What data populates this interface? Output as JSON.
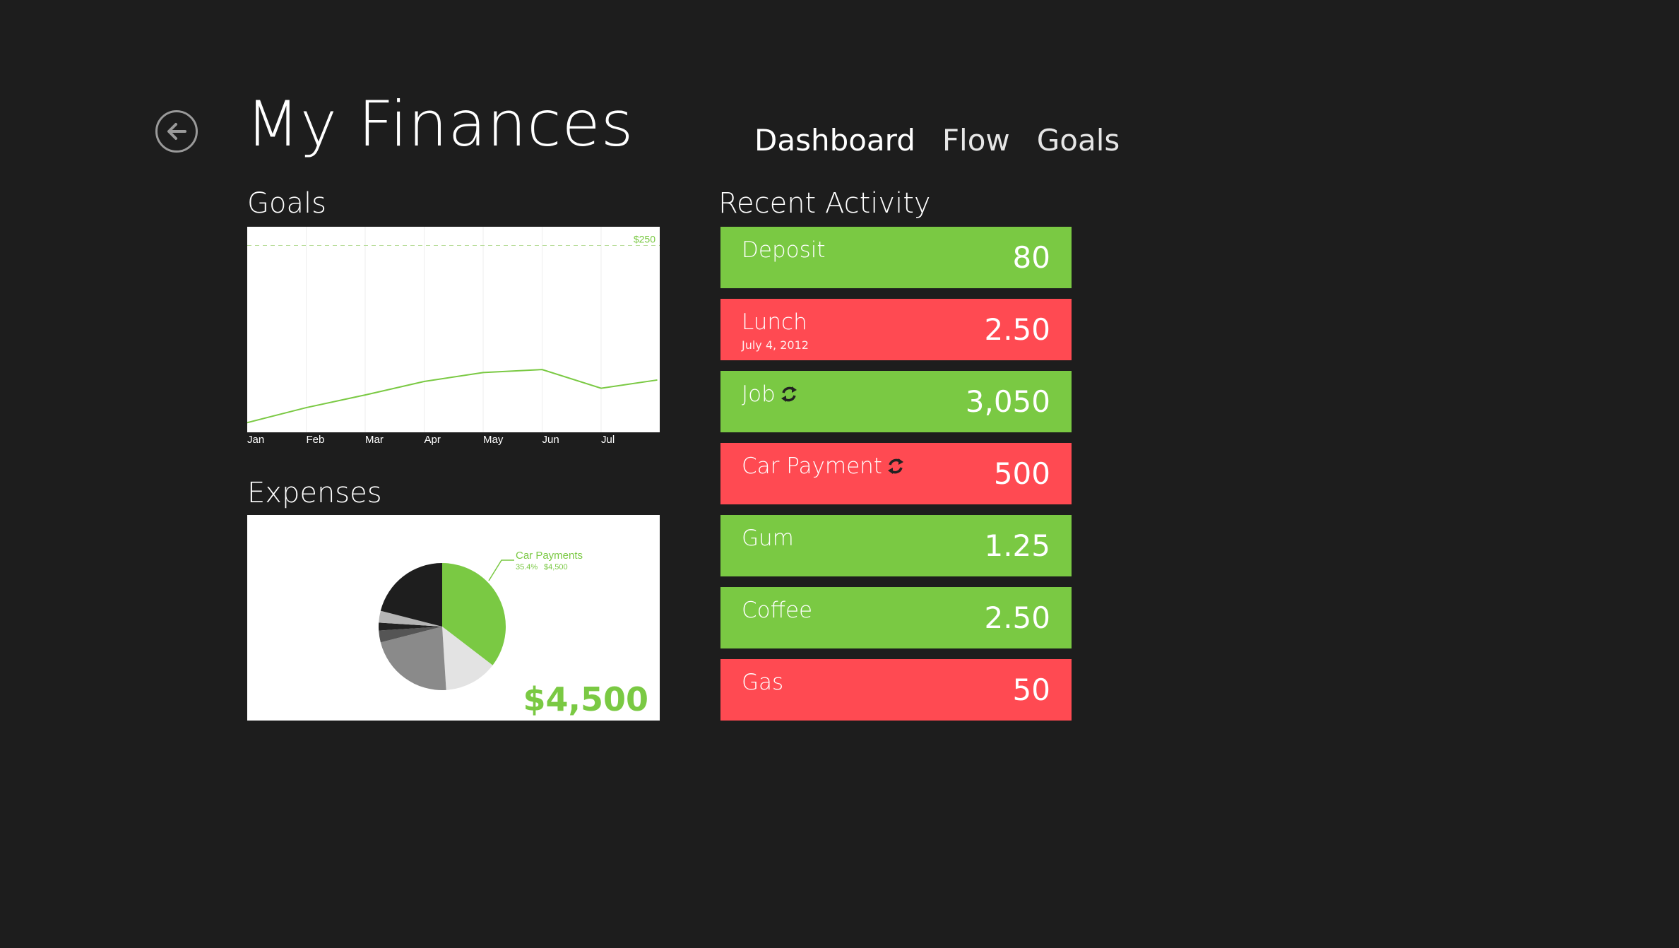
{
  "header": {
    "title": "My Finances",
    "nav": [
      "Dashboard",
      "Flow",
      "Goals"
    ],
    "active_nav": "Dashboard"
  },
  "goals": {
    "title": "Goals",
    "chart_data": {
      "type": "line",
      "categories": [
        "Jan",
        "Feb",
        "Mar",
        "Apr",
        "May",
        "Jun",
        "Jul",
        ""
      ],
      "values": [
        13,
        33,
        50,
        68,
        80,
        84,
        59,
        70
      ],
      "target_value": 250,
      "target_label": "$250",
      "ylim": [
        0,
        275
      ],
      "grid": "vertical",
      "line_color": "#7ac943"
    }
  },
  "expenses": {
    "title": "Expenses",
    "total": "$4,500",
    "callout_label": "Car Payments",
    "callout_percent": "35.4%",
    "callout_value": "$4,500",
    "chart_data": {
      "type": "pie",
      "slices": [
        {
          "name": "Car Payments",
          "value": 35.4,
          "color": "#7ac943"
        },
        {
          "value": 13.6,
          "color": "#e3e3e3"
        },
        {
          "value": 22,
          "color": "#8a8a8a"
        },
        {
          "value": 3,
          "color": "#555555"
        },
        {
          "value": 2,
          "color": "#222222"
        },
        {
          "value": 3,
          "color": "#b5b5b5"
        },
        {
          "value": 21,
          "color": "#1e1e1e"
        }
      ]
    }
  },
  "activity": {
    "title": "Recent Activity",
    "items": [
      {
        "label": "Deposit",
        "sub": "",
        "amount": "80",
        "type": "income",
        "recurring": false
      },
      {
        "label": "Lunch",
        "sub": "July 4, 2012",
        "amount": "2.50",
        "type": "expense",
        "recurring": false
      },
      {
        "label": "Job",
        "sub": "",
        "amount": "3,050",
        "type": "income",
        "recurring": true
      },
      {
        "label": "Car Payment",
        "sub": "",
        "amount": "500",
        "type": "expense",
        "recurring": true
      },
      {
        "label": "Gum",
        "sub": "",
        "amount": "1.25",
        "type": "income",
        "recurring": false
      },
      {
        "label": "Coffee",
        "sub": "",
        "amount": "2.50",
        "type": "income",
        "recurring": false
      },
      {
        "label": "Gas",
        "sub": "",
        "amount": "50",
        "type": "expense",
        "recurring": false
      }
    ]
  },
  "colors": {
    "background": "#1d1d1d",
    "income": "#7ac943",
    "expense": "#ff4a52",
    "accent": "#7ac943"
  },
  "icons": {
    "back": "back-arrow-icon",
    "recurring": "recurring-sync-icon"
  }
}
